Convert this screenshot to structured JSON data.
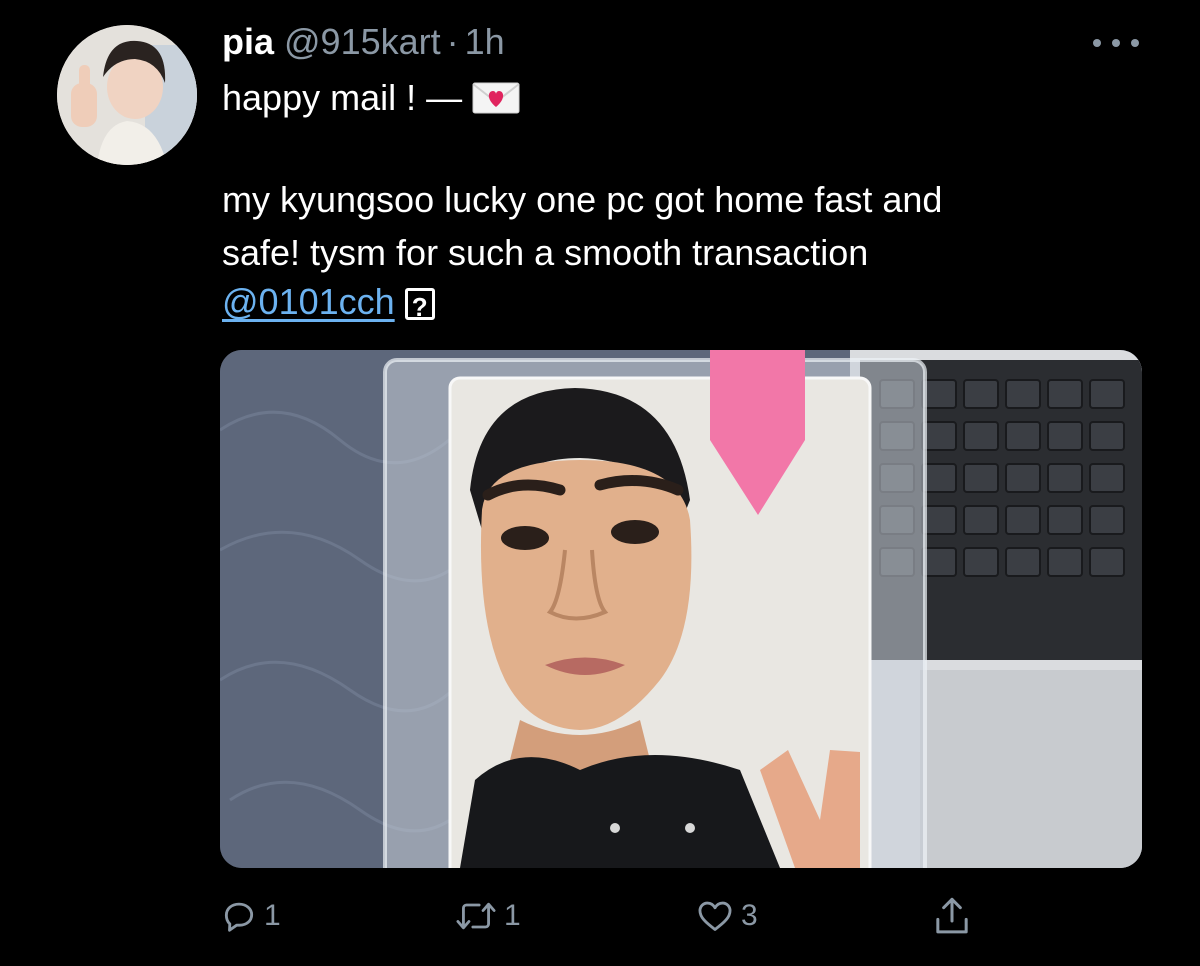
{
  "tweet": {
    "author_name": "pia",
    "author_handle": "@915kart",
    "separator": "·",
    "timestamp": "1h",
    "text_line1": "happy mail ! —",
    "text_line2": "my kyungsoo lucky one pc got home fast and",
    "text_line3": "safe! tysm for such a smooth transaction",
    "mention": "@0101cch",
    "unknown_glyph": "?"
  },
  "icons": {
    "avatar": "profile-photo",
    "more": "more-options-icon",
    "mail": "love-letter-emoji",
    "reply": "reply-icon",
    "retweet": "retweet-icon",
    "like": "heart-icon",
    "share": "share-icon"
  },
  "actions": {
    "reply_count": "1",
    "retweet_count": "1",
    "like_count": "3"
  },
  "colors": {
    "background": "#000000",
    "text": "#ffffff",
    "secondary_text": "#8b98a5",
    "mention": "#6cb2f0",
    "heart_emoji": "#e0245e"
  }
}
